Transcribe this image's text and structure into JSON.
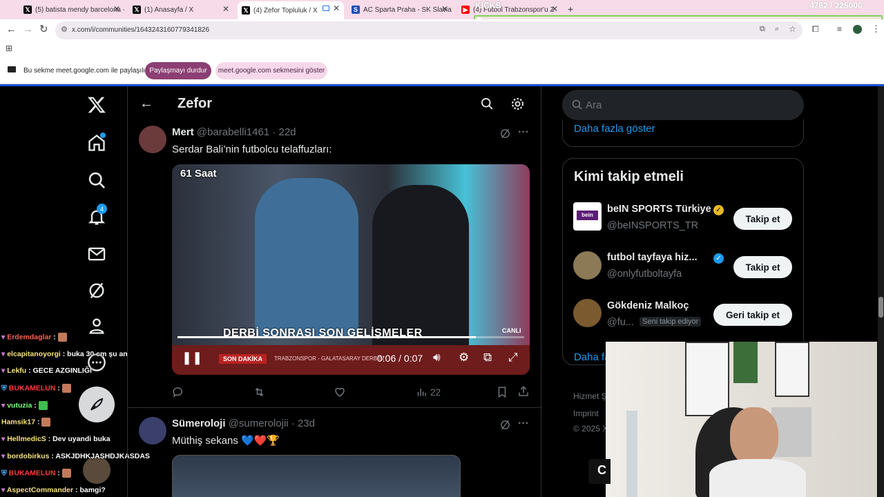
{
  "browser": {
    "tabs": [
      {
        "title": "(5) batista mendy barcelona - A",
        "icon": "x-logo-icon"
      },
      {
        "title": "(1) Anasayfa / X",
        "icon": "x-logo-icon"
      },
      {
        "title": "(4) Zefor Topluluk / X",
        "icon": "x-logo-icon"
      },
      {
        "title": "AC Sparta Praha - SK Slavia Pra",
        "icon": "sparta-icon"
      },
      {
        "title": "(4) Futbol Trabzonspor'u Z",
        "icon": "youtube-icon"
      }
    ],
    "new_tab": "+",
    "url": "x.com/i/communities/1643243160779341826",
    "overlay_counter": "4762 / 225000",
    "overlay_label": "KICKS"
  },
  "share_bar": {
    "text": "Bu sekme meet.google.com ile paylaşılıyor",
    "stop_button": "Paylaşmayı durdur",
    "show_button": "meet.google.com sekmesini göster"
  },
  "x": {
    "header": {
      "title": "Zefor"
    },
    "notifications_badge": "4",
    "posts": [
      {
        "name": "Mert",
        "handle": "@barabelli1461",
        "time": "· 22d",
        "text": "Serdar Bali’nin futbolcu telaffuzları:",
        "video": {
          "time": "0:06 / 0:07",
          "progress": 0.86,
          "overlay_tag": "61 Saat",
          "headline": "DERBİ SONRASI SON GELİŞMELER",
          "live": "CANLI",
          "ticker_tag": "SON DAKİKA",
          "ticker": "TRABZONSPOR - GALATASARAY DERBİSİ"
        },
        "views": "22"
      },
      {
        "name": "Sümeroloji",
        "handle": "@sumerolojii",
        "time": "· 23d",
        "text": "Müthiş sekans 💙❤️🏆"
      }
    ],
    "search_placeholder": "Ara",
    "show_more": "Daha fazla göster",
    "who_to_follow": {
      "title": "Kimi takip etmeli",
      "items": [
        {
          "name": "beIN SPORTS Türkiye",
          "handle": "@beINSPORTS_TR",
          "button": "Takip et",
          "verified": "gold"
        },
        {
          "name": "futbol tayfaya hiz...",
          "handle": "@onlyfutboltayfa",
          "button": "Takip et",
          "verified": "blue"
        },
        {
          "name": "Gökdeniz Malkoç",
          "handle": "@fu...",
          "button": "Geri takip et",
          "note": "Seni takip ediyor"
        }
      ],
      "show_more_partial": "Daha fa"
    },
    "footer": {
      "line1": "Hizmet Ş",
      "line2": "Imprint",
      "line3": "© 2025 X"
    },
    "avatar_logo": "bein"
  },
  "chat": [
    {
      "user": "Erdemdaglar",
      "msg": ""
    },
    {
      "user": "elcapitanoyorgi",
      "msg": "buka 30 cm şu an"
    },
    {
      "user": "Lekfu",
      "msg": "GECE AZGINLIĞI"
    },
    {
      "user": "BUKAMELUN",
      "msg": ""
    },
    {
      "user": "vutuzia",
      "msg": ""
    },
    {
      "user": "Hamsik17",
      "msg": ""
    },
    {
      "user": "HellmedicS",
      "msg": "Dev uyandi buka"
    },
    {
      "user": "bordobirkus",
      "msg": "ASKJDHKJASHDJKASDAS"
    },
    {
      "user": "BUKAMELUN",
      "msg": ""
    },
    {
      "user": "AspectCommander",
      "msg": "bamgi?"
    }
  ],
  "colors": {
    "tabbar": "#f7dbe9",
    "accent": "#1d9bf0",
    "x_bg": "#000000",
    "share_stop": "#8b3f72",
    "share_show": "#f6d8ea"
  }
}
